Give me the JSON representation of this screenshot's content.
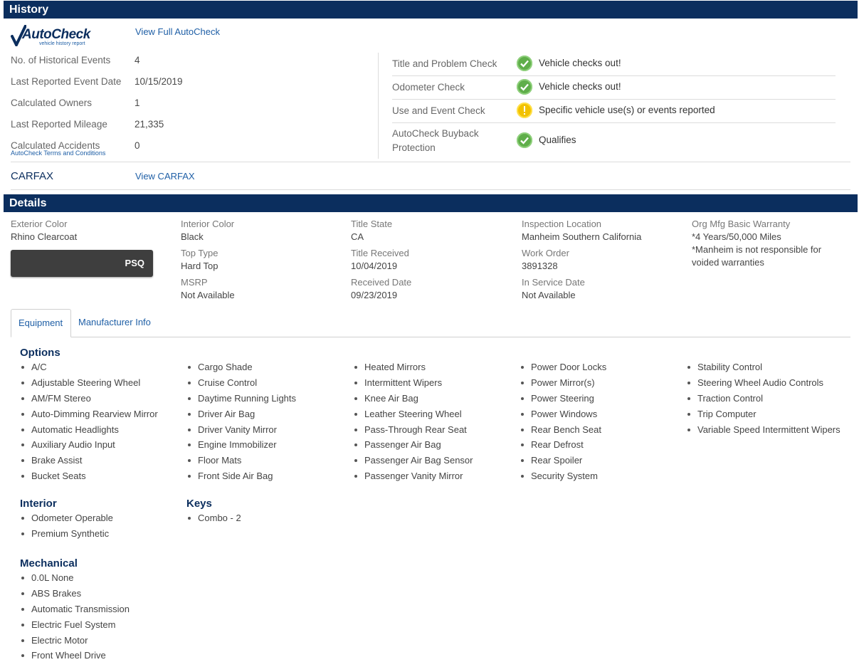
{
  "history": {
    "header": "History",
    "autocheck_logo": "AutoCheck",
    "autocheck_tagline": "vehicle history report",
    "view_autocheck": "View Full AutoCheck",
    "rows": [
      {
        "label": "No. of Historical Events",
        "value": "4"
      },
      {
        "label": "Last Reported Event Date",
        "value": "10/15/2019"
      },
      {
        "label": "Calculated Owners",
        "value": "1"
      },
      {
        "label": "Last Reported Mileage",
        "value": "21,335"
      },
      {
        "label": "Calculated Accidents",
        "value": "0"
      }
    ],
    "terms": "AutoCheck Terms and Conditions",
    "checks": [
      {
        "label": "Title and Problem Check",
        "status": "ok",
        "text": "Vehicle checks out!"
      },
      {
        "label": "Odometer Check",
        "status": "ok",
        "text": "Vehicle checks out!"
      },
      {
        "label": "Use and Event Check",
        "status": "warn",
        "text": "Specific vehicle use(s) or events reported"
      },
      {
        "label_line1": "AutoCheck Buyback",
        "label_line2": "Protection",
        "status": "ok",
        "text": "Qualifies"
      }
    ],
    "carfax_label": "CARFAX",
    "view_carfax": "View CARFAX"
  },
  "details": {
    "header": "Details",
    "exterior_color_label": "Exterior Color",
    "exterior_color": "Rhino Clearcoat",
    "psq": "PSQ",
    "interior_color_label": "Interior Color",
    "interior_color": "Black",
    "top_type_label": "Top Type",
    "top_type": "Hard Top",
    "msrp_label": "MSRP",
    "msrp": "Not Available",
    "title_state_label": "Title State",
    "title_state": "CA",
    "title_received_label": "Title Received",
    "title_received": "10/04/2019",
    "received_date_label": "Received Date",
    "received_date": "09/23/2019",
    "inspection_location_label": "Inspection Location",
    "inspection_location": "Manheim Southern California",
    "work_order_label": "Work Order",
    "work_order": "3891328",
    "in_service_date_label": "In Service Date",
    "in_service_date": "Not Available",
    "warranty_label": "Org Mfg Basic Warranty",
    "warranty": "*4 Years/50,000 Miles",
    "warranty_note_1": "*Manheim is not responsible for",
    "warranty_note_2": "voided warranties"
  },
  "tabs": {
    "equipment": "Equipment",
    "manufacturer": "Manufacturer Info"
  },
  "equipment": {
    "options_title": "Options",
    "options_cols": [
      [
        "A/C",
        "Adjustable Steering Wheel",
        "AM/FM Stereo",
        "Auto-Dimming Rearview Mirror",
        "Automatic Headlights",
        "Auxiliary Audio Input",
        "Brake Assist",
        "Bucket Seats"
      ],
      [
        "Cargo Shade",
        "Cruise Control",
        "Daytime Running Lights",
        "Driver Air Bag",
        "Driver Vanity Mirror",
        "Engine Immobilizer",
        "Floor Mats",
        "Front Side Air Bag"
      ],
      [
        "Heated Mirrors",
        "Intermittent Wipers",
        "Knee Air Bag",
        "Leather Steering Wheel",
        "Pass-Through Rear Seat",
        "Passenger Air Bag",
        "Passenger Air Bag Sensor",
        "Passenger Vanity Mirror"
      ],
      [
        "Power Door Locks",
        "Power Mirror(s)",
        "Power Steering",
        "Power Windows",
        "Rear Bench Seat",
        "Rear Defrost",
        "Rear Spoiler",
        "Security System"
      ],
      [
        "Stability Control",
        "Steering Wheel Audio Controls",
        "Traction Control",
        "Trip Computer",
        "Variable Speed Intermittent Wipers"
      ]
    ],
    "interior_title": "Interior",
    "interior": [
      "Odometer Operable",
      "Premium Synthetic"
    ],
    "keys_title": "Keys",
    "keys": [
      "Combo - 2"
    ],
    "mechanical_title": "Mechanical",
    "mechanical": [
      "0.0L None",
      "ABS Brakes",
      "Automatic Transmission",
      "Electric Fuel System",
      "Electric Motor",
      "Front Wheel Drive"
    ]
  }
}
